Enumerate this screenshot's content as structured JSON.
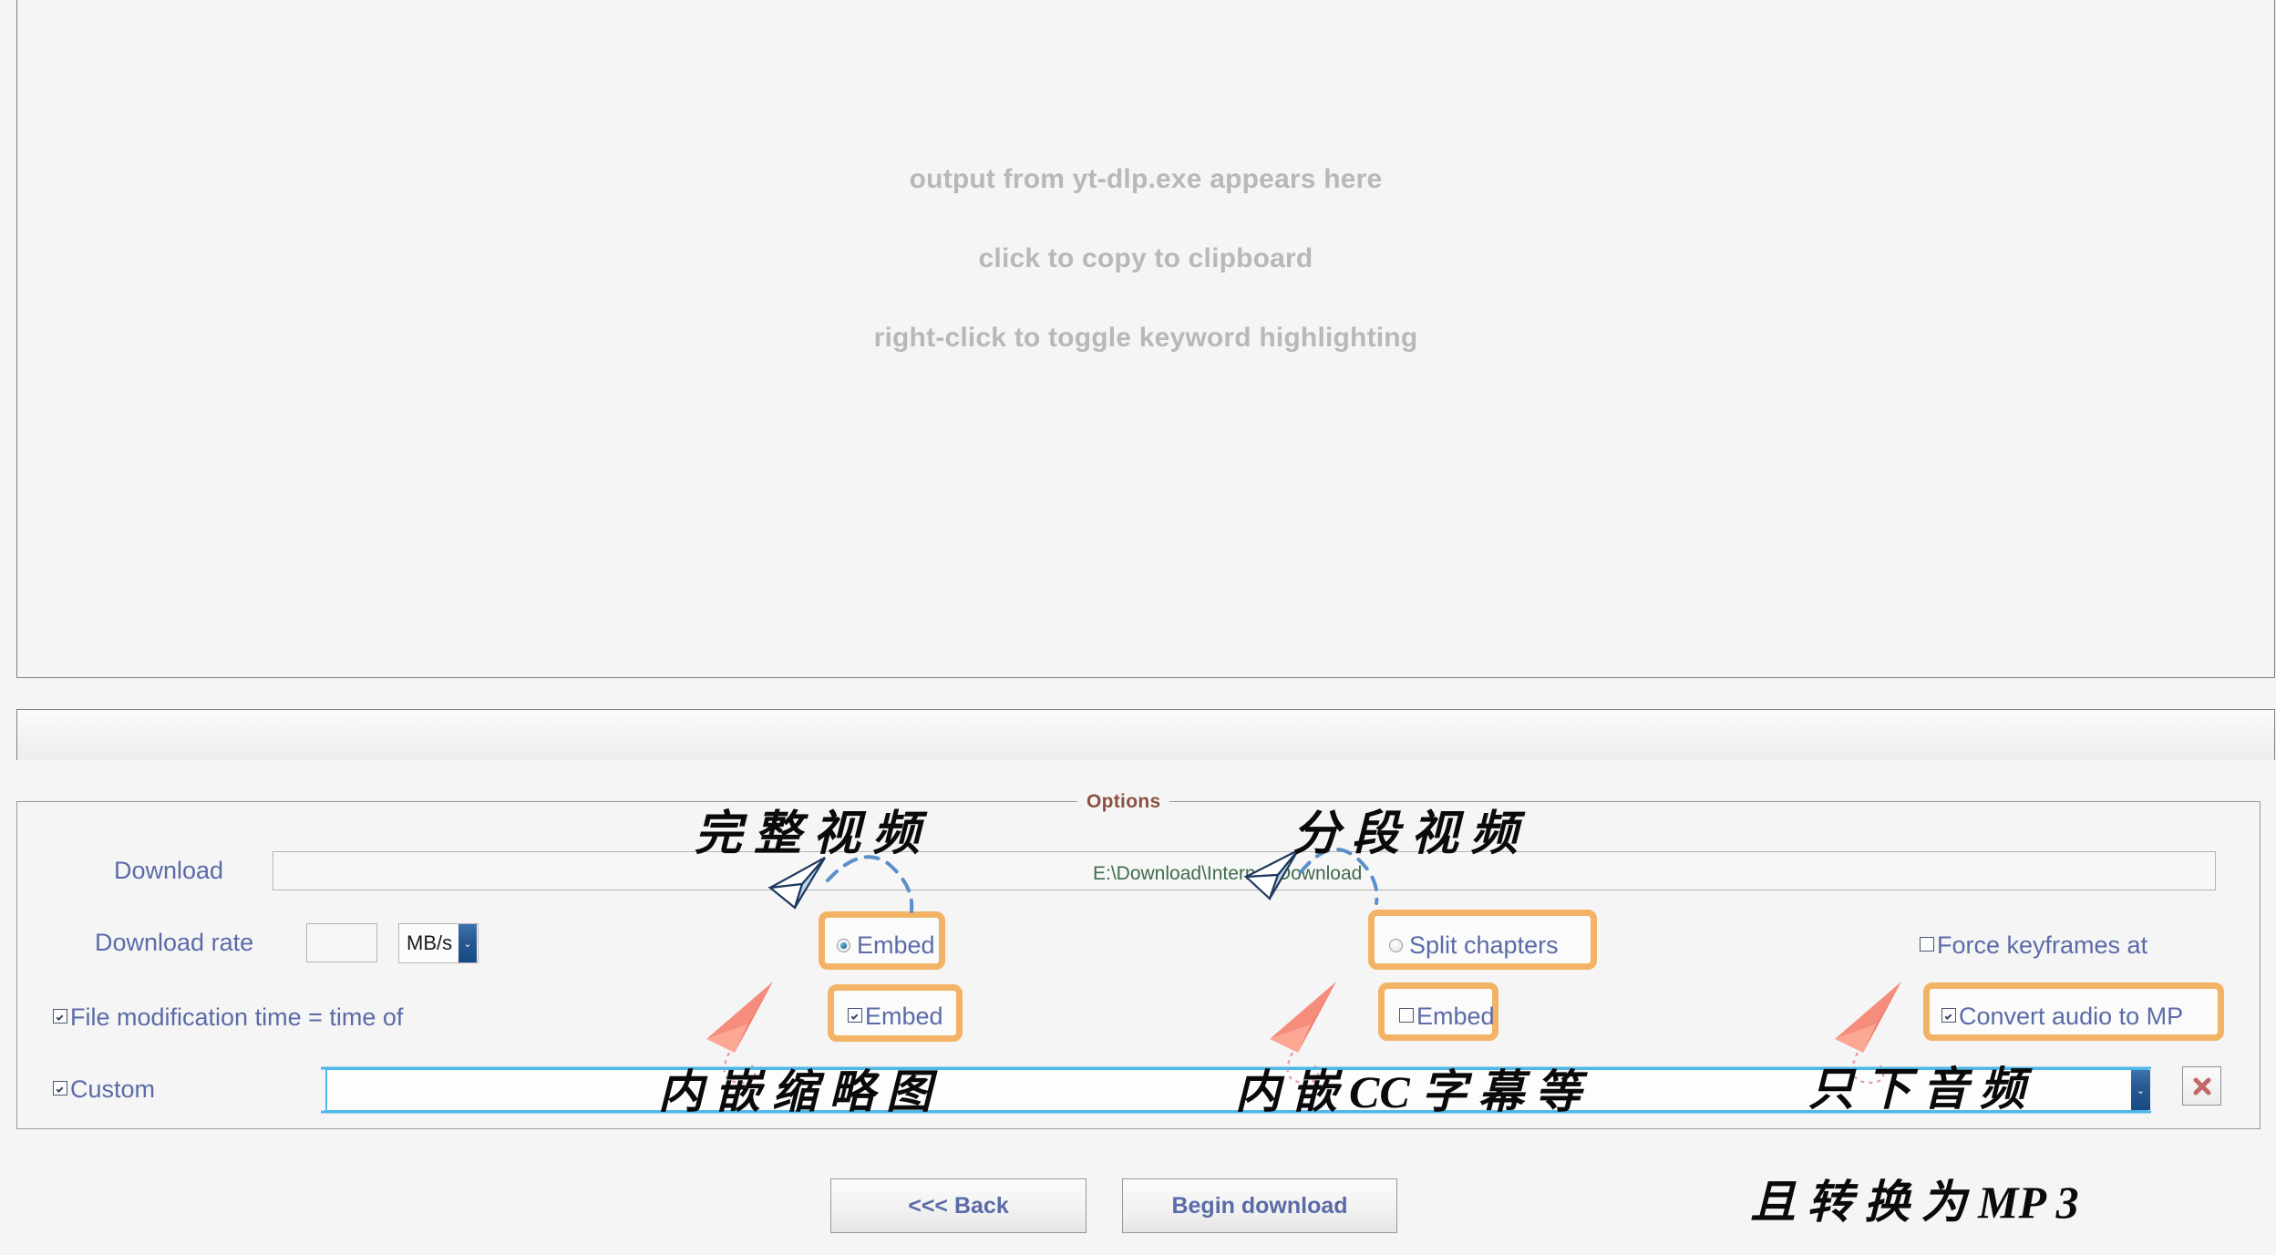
{
  "console": {
    "placeholder_lines": [
      "output from yt-dlp.exe appears here",
      "click to copy to clipboard",
      "right-click to toggle keyword highlighting"
    ]
  },
  "options": {
    "legend": "Options",
    "download_label": "Download",
    "download_path_value": "E:\\Download\\Internet Download",
    "download_rate_label": "Download rate",
    "download_rate_value": "",
    "rate_unit_selected": "MB/s",
    "file_mod_time_label": "File modification time = time of",
    "file_mod_time_checked": true,
    "custom_label": "Custom",
    "custom_checked": true,
    "custom_value": "",
    "embed_thumbnail_label": "Embed",
    "embed_thumbnail_selected": true,
    "embed_subs_label": "Embed",
    "embed_subs_checked": true,
    "split_chapters_label": "Split chapters",
    "split_chapters_selected": false,
    "embed_chapters_label": "Embed",
    "embed_chapters_checked": false,
    "force_keyframes_label": "Force keyframes at",
    "force_keyframes_checked": false,
    "convert_audio_label": "Convert audio to MP",
    "convert_audio_checked": true
  },
  "footer": {
    "back_label": "<<< Back",
    "begin_label": "Begin download"
  },
  "annotations": {
    "full_video": "完 整 视 频",
    "split_video": "分 段 视 频",
    "embed_thumb": "内 嵌 缩 略 图",
    "embed_cc": "内 嵌 CC 字 幕 等",
    "audio_only": "只 下 音 频",
    "convert_mp3": "且 转 换 为 MP 3"
  },
  "colors": {
    "legend": "#8a5242",
    "label": "#5b6ba8",
    "path": "#3f6b4c",
    "highlight": "#f3b367",
    "focus": "#4db8e8",
    "placeholder": "#b8b8b8"
  },
  "icons": {
    "dropdown_arrow": "⌄",
    "delete": "✖"
  }
}
